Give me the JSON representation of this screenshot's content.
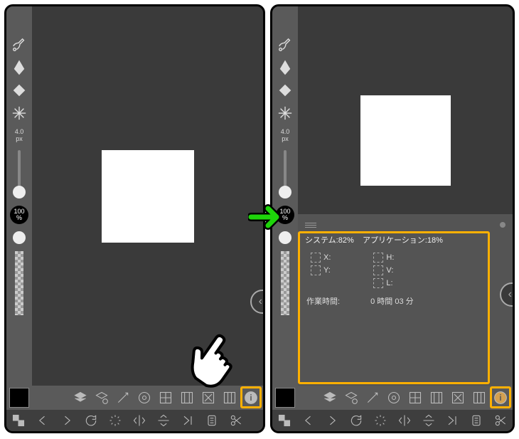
{
  "brush": {
    "size_label": "4.0\npx"
  },
  "zoom": {
    "value": "100",
    "unit": "%"
  },
  "info_panel": {
    "mem": {
      "system_label": "システム:",
      "system_val": "82%",
      "app_label": "アプリケーション:",
      "app_val": "18%"
    },
    "coords": {
      "x_label": "X:",
      "y_label": "Y:",
      "h_label": "H:",
      "v_label": "V:",
      "l_label": "L:"
    },
    "work": {
      "label": "作業時間:",
      "value": "0 時間 03 分"
    }
  },
  "icons": {
    "menu": "menu",
    "expand": "expand",
    "tools": [
      "cut-eraser",
      "pen",
      "bucket",
      "sparkle"
    ],
    "bottom1": [
      "layers",
      "layers-settings",
      "wand",
      "target",
      "grid",
      "film",
      "x-box",
      "panels",
      "info"
    ],
    "bottom2": [
      "checker",
      "back",
      "forward",
      "rotate",
      "loading",
      "hflip",
      "vflip",
      "skip-end",
      "clipboard",
      "scissors"
    ]
  }
}
